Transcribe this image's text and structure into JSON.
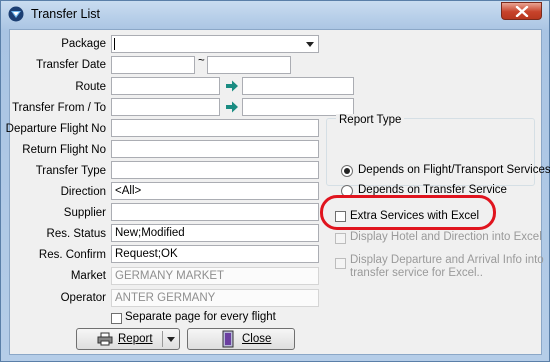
{
  "window": {
    "title": "Transfer List"
  },
  "labels": {
    "package": "Package",
    "transfer_date": "Transfer Date",
    "route": "Route",
    "transfer_from_to": "Transfer From / To",
    "departure_flight_no": "Departure Flight No",
    "return_flight_no": "Return Flight No",
    "transfer_type": "Transfer Type",
    "direction": "Direction",
    "supplier": "Supplier",
    "res_status": "Res. Status",
    "res_confirm": "Res. Confirm",
    "market": "Market",
    "operator": "Operator"
  },
  "fields": {
    "package": "",
    "transfer_date_from": "",
    "date_separator": "~",
    "transfer_date_to": "",
    "route_from": "",
    "route_to": "",
    "transfer_from": "",
    "transfer_to": "",
    "departure_flight_no": "",
    "return_flight_no": "",
    "transfer_type": "",
    "direction": "<All>",
    "supplier": "",
    "res_status": "New;Modified",
    "res_confirm": "Request;OK",
    "market": "GERMANY MARKET",
    "operator": "ANTER GERMANY"
  },
  "report_type": {
    "title": "Report Type",
    "options": [
      "Depends on Flight/Transport Services",
      "Depends on Transfer Service"
    ],
    "selected_index": 0
  },
  "checkboxes": {
    "extra_services_excel": {
      "label": "Extra Services with Excel",
      "checked": false
    },
    "display_hotel_direction": {
      "label": "Display Hotel and Direction into Excel",
      "checked": false
    },
    "display_departure_arrival_line1": "Display Departure and Arrival Info into",
    "display_departure_arrival_line2": "transfer service for Excel..",
    "separate_page": {
      "label": "Separate page for every flight",
      "checked": false
    }
  },
  "buttons": {
    "report": "Report",
    "close": "Close"
  },
  "colors": {
    "highlight": "#e0141e",
    "close_button": "#c7432b",
    "arrow": "#1a8c82"
  }
}
